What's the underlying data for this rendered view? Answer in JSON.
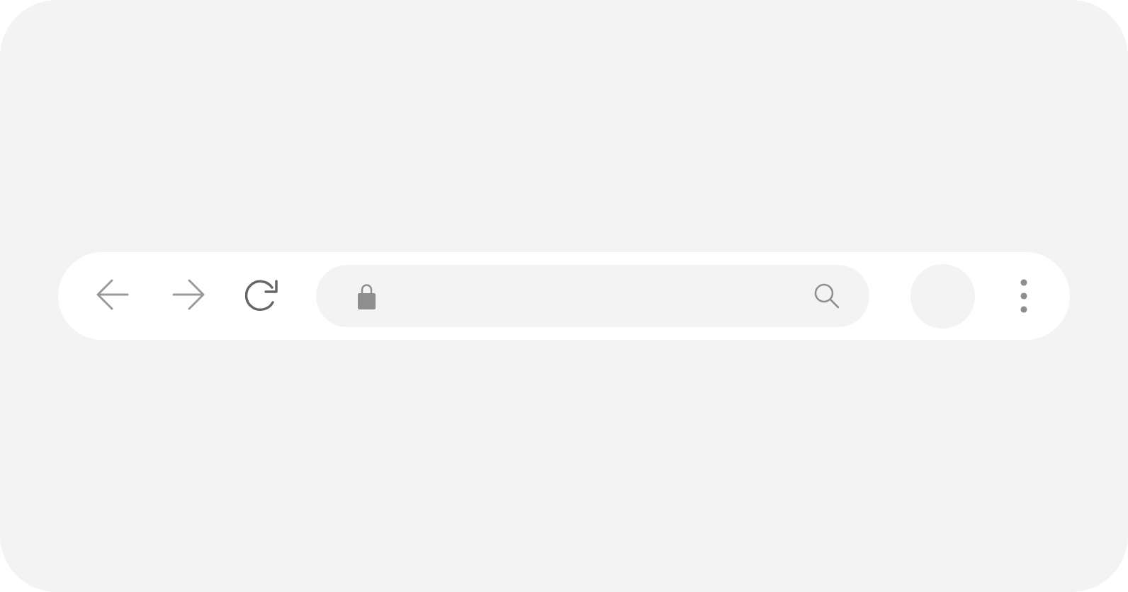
{
  "toolbar": {
    "nav_buttons": [
      {
        "kind": "back",
        "disabled": true
      },
      {
        "kind": "forward",
        "disabled": true
      },
      {
        "kind": "reload",
        "disabled": false
      }
    ],
    "address_bar": {
      "secure": true
    }
  }
}
